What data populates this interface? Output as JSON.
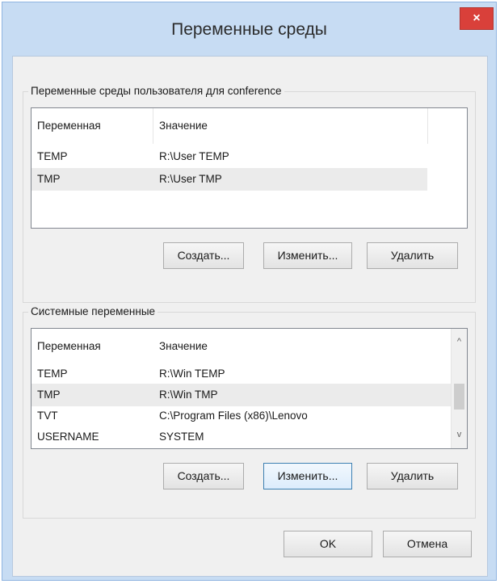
{
  "window": {
    "title": "Переменные среды",
    "close_glyph": "×"
  },
  "user_group": {
    "label": "Переменные среды пользователя для conference",
    "columns": [
      "Переменная",
      "Значение"
    ],
    "rows": [
      {
        "name": "TEMP",
        "value": "R:\\User TEMP",
        "selected": false
      },
      {
        "name": "TMP",
        "value": "R:\\User TMP",
        "selected": true
      }
    ],
    "buttons": {
      "create": "Создать...",
      "edit": "Изменить...",
      "delete": "Удалить"
    }
  },
  "system_group": {
    "label": "Системные переменные",
    "columns": [
      "Переменная",
      "Значение"
    ],
    "rows": [
      {
        "name": "TEMP",
        "value": "R:\\Win TEMP",
        "selected": false
      },
      {
        "name": "TMP",
        "value": "R:\\Win TMP",
        "selected": true
      },
      {
        "name": "TVT",
        "value": "C:\\Program Files (x86)\\Lenovo",
        "selected": false
      },
      {
        "name": "USERNAME",
        "value": "SYSTEM",
        "selected": false
      }
    ],
    "scroll_up_glyph": "^",
    "scroll_down_glyph": "v",
    "buttons": {
      "create": "Создать...",
      "edit": "Изменить...",
      "delete": "Удалить"
    }
  },
  "footer": {
    "ok": "OK",
    "cancel": "Отмена"
  },
  "colors": {
    "close_button": "#d9403a",
    "frame": "#c7dcf3",
    "selection": "#ebebeb"
  }
}
